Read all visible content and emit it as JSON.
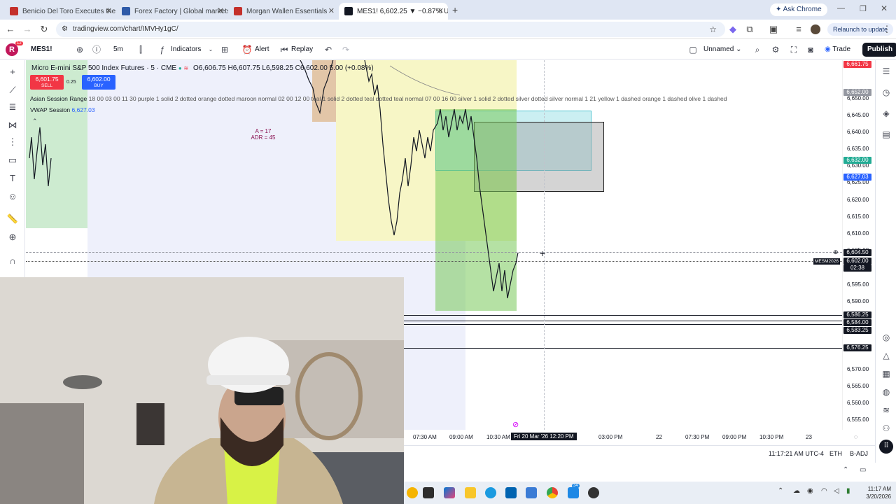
{
  "browser": {
    "tabs": [
      {
        "title": "Benicio Del Toro Executes the C",
        "color": "#c4302b"
      },
      {
        "title": "Forex Factory | Global markets",
        "color": "#2e5aa8"
      },
      {
        "title": "Morgan Wallen Essentials",
        "color": "#c4302b"
      },
      {
        "title": "MES1! 6,602.25 ▼ −0.87% Unn",
        "color": "#131722"
      }
    ],
    "ask_chrome": "Ask Chrome",
    "url": "tradingview.com/chart/IMVHy1gC/",
    "relaunch": "Relaunch to update"
  },
  "toolbar": {
    "avatar_letter": "R",
    "badge": "12",
    "symbol": "MES1!",
    "interval": "5m",
    "indicators": "Indicators",
    "alert": "Alert",
    "replay": "Replay",
    "layout_name": "Unnamed",
    "trade": "Trade",
    "publish": "Publish"
  },
  "legend": {
    "instrument": "Micro E-mini S&P 500 Index Futures · 5 · CME",
    "ohlc": "O6,606.75 H6,607.75 L6,598.25 C6,602.00  5.00 (+0.08%)",
    "sell_price": "6,601.75",
    "sell_label": "SELL",
    "spread": "0.25",
    "buy_price": "6,602.00",
    "buy_label": "BUY",
    "asian_range_label": "Asian Session Range",
    "asian_range_params": "18 00 03 00 11 30 purple 1 solid 2 dotted orange dotted maroon normal 02 00 12 00 teal 1 solid 2 dotted teal dotted teal normal 07 00 16 00 silver 1 solid 2 dotted silver dotted silver normal 1 21 yellow 1 dashed orange 1 dashed olive 1 dashed",
    "vwap_label": "VWAP Session",
    "vwap_value": "6,627.03"
  },
  "annotation": {
    "line1": "A = 17",
    "line2": "ADR = 45"
  },
  "price_axis": {
    "ticks": [
      "6,650.00",
      "6,645.00",
      "6,640.00",
      "6,635.00",
      "6,630.00",
      "6,625.00",
      "6,620.00",
      "6,615.00",
      "6,610.00",
      "6,605.00",
      "6,595.00",
      "6,590.00",
      "6,570.00",
      "6,565.00",
      "6,560.00",
      "6,555.00"
    ],
    "labels": [
      {
        "text": "6,661.75",
        "color": "#f23645"
      },
      {
        "text": "6,652.00",
        "color": "#9598a1"
      },
      {
        "text": "6,632.00",
        "color": "#22ab94"
      },
      {
        "text": "6,627.03",
        "color": "#2962ff"
      },
      {
        "text": "6,604.50",
        "color": "#131722"
      },
      {
        "text": "6,602.00",
        "color": "#131722"
      },
      {
        "text": "02:38",
        "color": "#131722"
      },
      {
        "text": "6,586.25",
        "color": "#131722"
      },
      {
        "text": "6,584.00",
        "color": "#131722"
      },
      {
        "text": "6,583.25",
        "color": "#131722"
      },
      {
        "text": "6,576.25",
        "color": "#131722"
      }
    ],
    "contract_tag": "MESM2026"
  },
  "time_axis": {
    "ticks": [
      "07:30 AM",
      "09:00 AM",
      "10:30 AM",
      "03:00 PM",
      "22",
      "07:30 PM",
      "09:00 PM",
      "10:30 PM",
      "23"
    ],
    "cursor_label": "Fri 20 Mar '26   12:20 PM"
  },
  "status_bar": {
    "clock": "11:17:21 AM UTC-4",
    "session": "ETH",
    "adjust": "B-ADJ"
  },
  "taskbar": {
    "time": "11:17 AM",
    "date": "3/20/2026",
    "badge": "34"
  }
}
